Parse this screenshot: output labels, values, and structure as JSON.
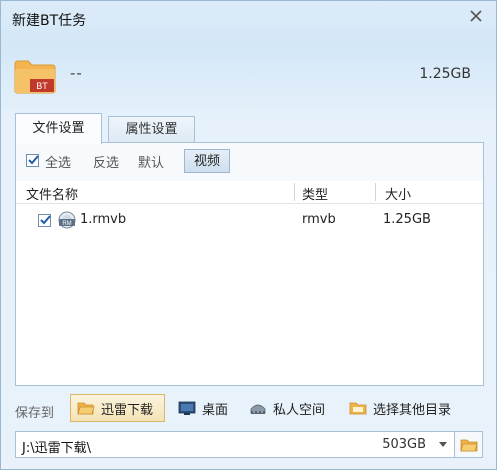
{
  "window": {
    "title": "新建BT任务"
  },
  "task": {
    "name": "--",
    "size": "1.25GB",
    "badge": "BT"
  },
  "tabs": [
    {
      "label": "文件设置",
      "active": true
    },
    {
      "label": "属性设置",
      "active": false
    }
  ],
  "filters": {
    "select_all": "全选",
    "select_all_checked": true,
    "invert": "反选",
    "default": "默认",
    "video": "视频"
  },
  "columns": {
    "name": "文件名称",
    "type": "类型",
    "size": "大小"
  },
  "files": [
    {
      "checked": true,
      "icon": "rm-file-icon",
      "icon_text": "RM",
      "name": "1.rmvb",
      "type": "rmvb",
      "size": "1.25GB"
    }
  ],
  "save": {
    "label": "保存到",
    "options": [
      {
        "label": "迅雷下载",
        "icon": "folder-open-icon",
        "selected": true
      },
      {
        "label": "桌面",
        "icon": "desktop-icon",
        "selected": false
      },
      {
        "label": "私人空间",
        "icon": "private-space-icon",
        "selected": false
      },
      {
        "label": "选择其他目录",
        "icon": "folder-icon",
        "selected": false
      }
    ],
    "path": "J:\\迅雷下载\\",
    "free_space": "503GB"
  },
  "colors": {
    "accent": "#d8b86a",
    "border": "#a9c1d8",
    "bt_badge": "#c0392b",
    "folder": "#f0b34a"
  }
}
